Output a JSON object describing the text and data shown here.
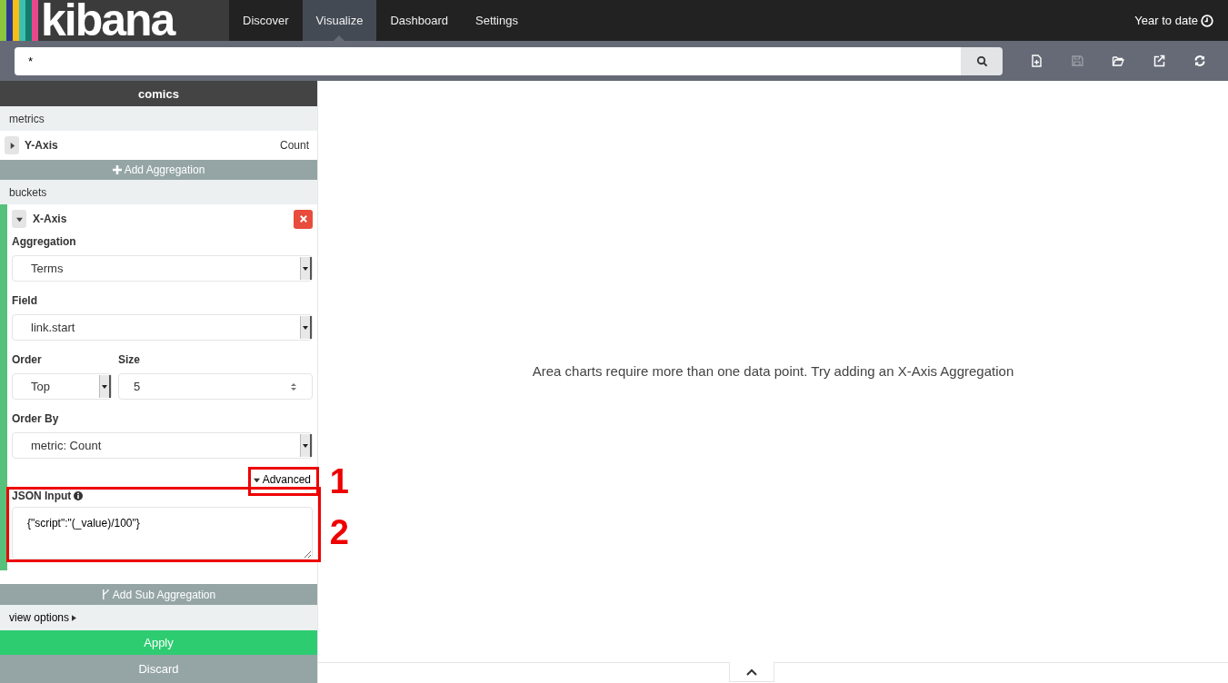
{
  "logo": {
    "text": "kibana"
  },
  "nav": [
    {
      "label": "Discover",
      "selected": false
    },
    {
      "label": "Visualize",
      "selected": true
    },
    {
      "label": "Dashboard",
      "selected": false
    },
    {
      "label": "Settings",
      "selected": false
    }
  ],
  "time_filter": "Year to date",
  "query": {
    "value": "*"
  },
  "toolbar": [
    {
      "kind": "new",
      "disabled": false
    },
    {
      "kind": "save",
      "disabled": true
    },
    {
      "kind": "open",
      "disabled": false
    },
    {
      "kind": "share",
      "disabled": false
    },
    {
      "kind": "refresh",
      "disabled": false
    }
  ],
  "sidebar": {
    "title": "comics",
    "metrics": {
      "heading": "metrics",
      "items": [
        {
          "label": "Y-Axis",
          "value": "Count",
          "expanded": false
        }
      ],
      "add_button": "Add Aggregation"
    },
    "buckets": {
      "heading": "buckets",
      "items": [
        {
          "label": "X-Axis",
          "expanded": true,
          "aggregation": {
            "label": "Aggregation",
            "value": "Terms"
          },
          "field": {
            "label": "Field",
            "value": "link.start"
          },
          "order": {
            "label": "Order",
            "value": "Top"
          },
          "size": {
            "label": "Size",
            "value": "5"
          },
          "order_by": {
            "label": "Order By",
            "value": "metric: Count"
          },
          "advanced": {
            "label": "Advanced",
            "expanded": true
          },
          "json_input": {
            "label": "JSON Input",
            "value": "{\"script\":\"(_value)/100\"}"
          }
        }
      ],
      "add_button": "Add Sub Aggregation"
    },
    "view_options": "view options",
    "apply": "Apply",
    "discard": "Discard"
  },
  "message": "Area charts require more than one data point. Try adding an X-Axis Aggregation",
  "annotations": [
    {
      "number": "1"
    },
    {
      "number": "2"
    }
  ]
}
